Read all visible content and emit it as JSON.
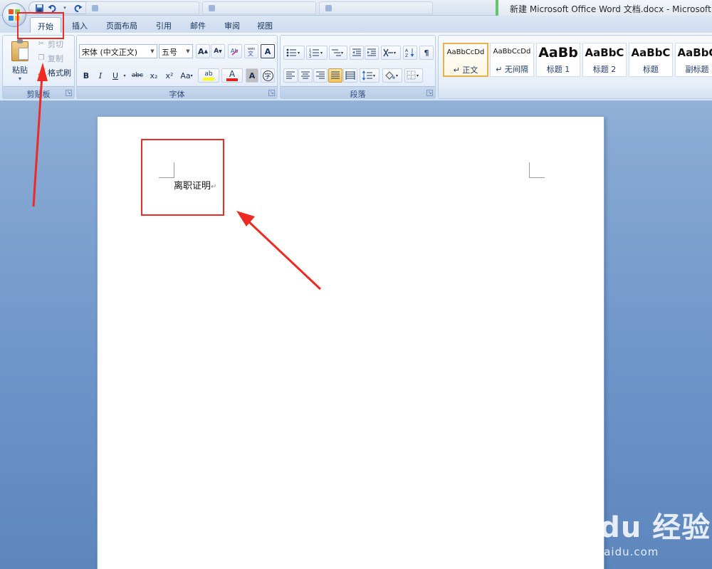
{
  "titlebar": {
    "document_title": "新建 Microsoft Office Word 文档.docx - Microsoft Word",
    "background_tabs": [
      "",
      "",
      ""
    ],
    "qat_icons": [
      "save-icon",
      "undo-icon",
      "redo-icon",
      "customize-icon"
    ]
  },
  "ribbon_tabs": [
    {
      "label": "开始",
      "active": true
    },
    {
      "label": "插入"
    },
    {
      "label": "页面布局"
    },
    {
      "label": "引用"
    },
    {
      "label": "邮件"
    },
    {
      "label": "审阅"
    },
    {
      "label": "视图"
    }
  ],
  "clipboard": {
    "group_label": "剪贴板",
    "paste_label": "粘贴",
    "cut_label": "剪切",
    "copy_label": "复制",
    "format_painter_label": "格式刷"
  },
  "font": {
    "group_label": "字体",
    "font_name": "宋体 (中文正文)",
    "font_size": "五号",
    "bold": "B",
    "italic": "I",
    "underline": "U",
    "strikethrough": "abc",
    "subscript": "x₂",
    "superscript": "x²",
    "change_case": "Aa",
    "grow_font": "A",
    "shrink_font": "A",
    "highlight": "ab",
    "font_color": "A",
    "char_shading": "A",
    "enclose": "字",
    "highlight_color": "#ffff00",
    "font_color_value": "#e2231a"
  },
  "paragraph": {
    "group_label": "段落"
  },
  "styles": {
    "cards": [
      {
        "sample": "AaBbCcDd",
        "name": "↵ 正文",
        "selected": true
      },
      {
        "sample": "AaBbCcDd",
        "name": "↵ 无间隔"
      },
      {
        "sample": "AaBb",
        "name": "标题 1"
      },
      {
        "sample": "AaBbC",
        "name": "标题 2"
      },
      {
        "sample": "AaBbC",
        "name": "标题"
      },
      {
        "sample": "AaBbC",
        "name": "副标题"
      }
    ]
  },
  "document": {
    "text": "离职证明",
    "pilcrow": "↵"
  },
  "watermark": {
    "main": "Baidu 经验",
    "sub": "jingyan.baidu.com"
  },
  "colors": {
    "annotation_red": "#ee2a24",
    "active_tab_outline": "#9ab5d8"
  }
}
